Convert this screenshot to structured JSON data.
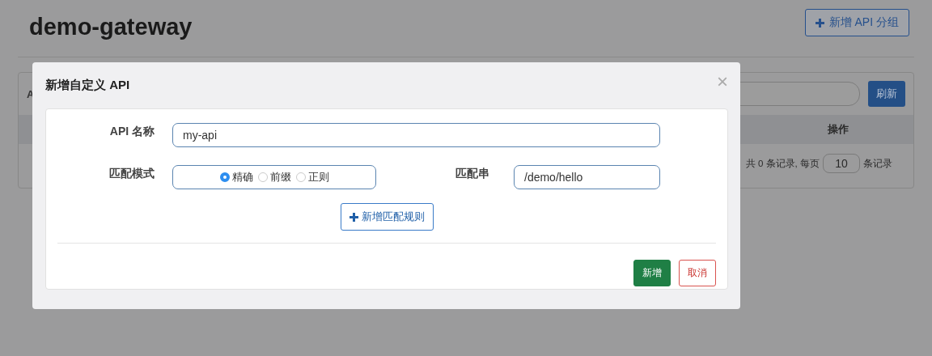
{
  "page": {
    "title": "demo-gateway",
    "add_group_button": "新增 API 分组",
    "panel": {
      "title_fragment": "A",
      "refresh_button": "刷新",
      "table": {
        "columns": [
          "操作"
        ]
      },
      "pagination": {
        "total_text": "共 0 条记录, 每页",
        "page_size": "10",
        "suffix": "条记录"
      }
    }
  },
  "dialog": {
    "title": "新增自定义 API",
    "close": "×",
    "fields": [
      {
        "label": "API 名称",
        "value": "my-api"
      }
    ],
    "match": {
      "label": "匹配模式",
      "options": [
        {
          "label": "精确",
          "selected": true
        },
        {
          "label": "前缀",
          "selected": false
        },
        {
          "label": "正则",
          "selected": false
        }
      ],
      "pattern_label": "匹配串",
      "pattern_value": "/demo/hello"
    },
    "add_rule_button": "新增匹配规则",
    "buttons": [
      {
        "label": "新增",
        "kind": "primary"
      },
      {
        "label": "取消",
        "kind": "cancel"
      }
    ]
  }
}
